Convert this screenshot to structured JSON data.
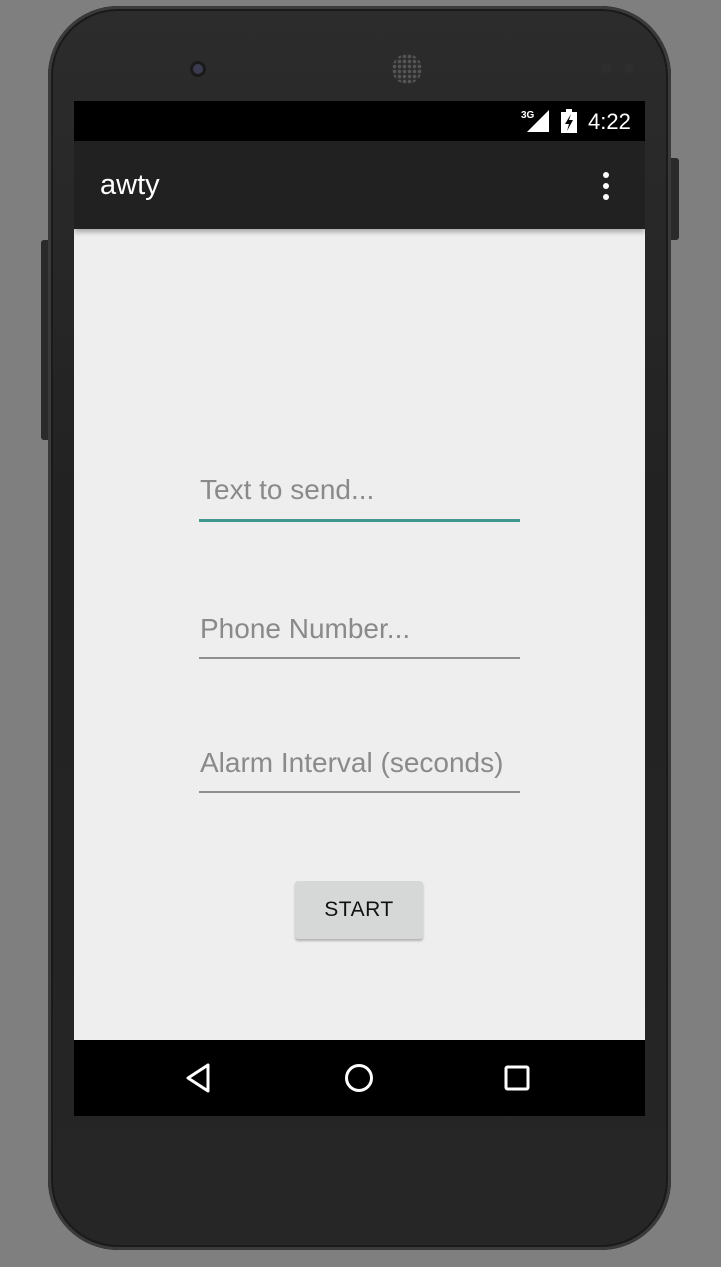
{
  "status_bar": {
    "network_type": "3G",
    "signal_icon": "signal-icon",
    "battery_icon": "battery-charging-icon",
    "time": "4:22"
  },
  "app_bar": {
    "title": "awty",
    "overflow_icon": "overflow-menu-icon",
    "background": "#212121"
  },
  "form": {
    "message": {
      "placeholder": "Text to send...",
      "value": ""
    },
    "phone": {
      "placeholder": "Phone Number...",
      "value": ""
    },
    "interval": {
      "placeholder": "Alarm Interval (seconds)",
      "value": ""
    },
    "start_label": "START",
    "accent_color": "#3f978e"
  },
  "nav_bar": {
    "back_icon": "back-icon",
    "home_icon": "home-icon",
    "recents_icon": "recents-icon"
  }
}
